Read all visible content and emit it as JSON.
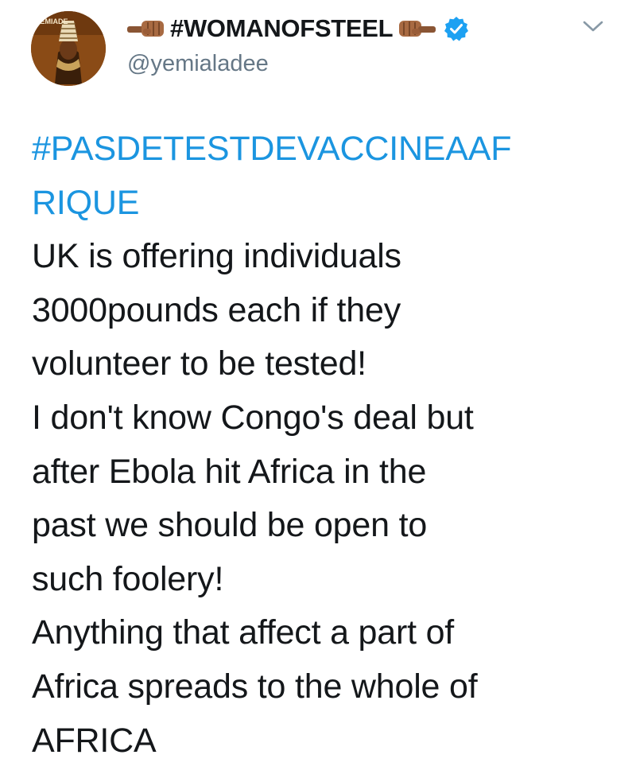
{
  "author": {
    "display_name": "#WOMANOFSTEEL",
    "handle": "@yemialadee",
    "verified": true,
    "name_emoji_left": "fist-left-emoji",
    "name_emoji_right": "fist-right-emoji",
    "avatar_label": "TEMIADE"
  },
  "menu": {
    "icon": "chevron-down-icon"
  },
  "tweet": {
    "hashtag_lines": [
      "#PASDETESTDEVACCINEAAF",
      "RIQUE"
    ],
    "lines": [
      "UK is offering individuals",
      "3000pounds each if they",
      "volunteer to be tested!",
      "I don't know Congo's deal but",
      "after Ebola hit Africa in the",
      "past we should be open to",
      "such foolery!",
      "Anything that affect a part of",
      "Africa spreads to the whole of",
      "AFRICA"
    ]
  },
  "colors": {
    "link": "#1b95e0",
    "text": "#14171a",
    "secondary": "#657786",
    "verified": "#1da1f2"
  }
}
